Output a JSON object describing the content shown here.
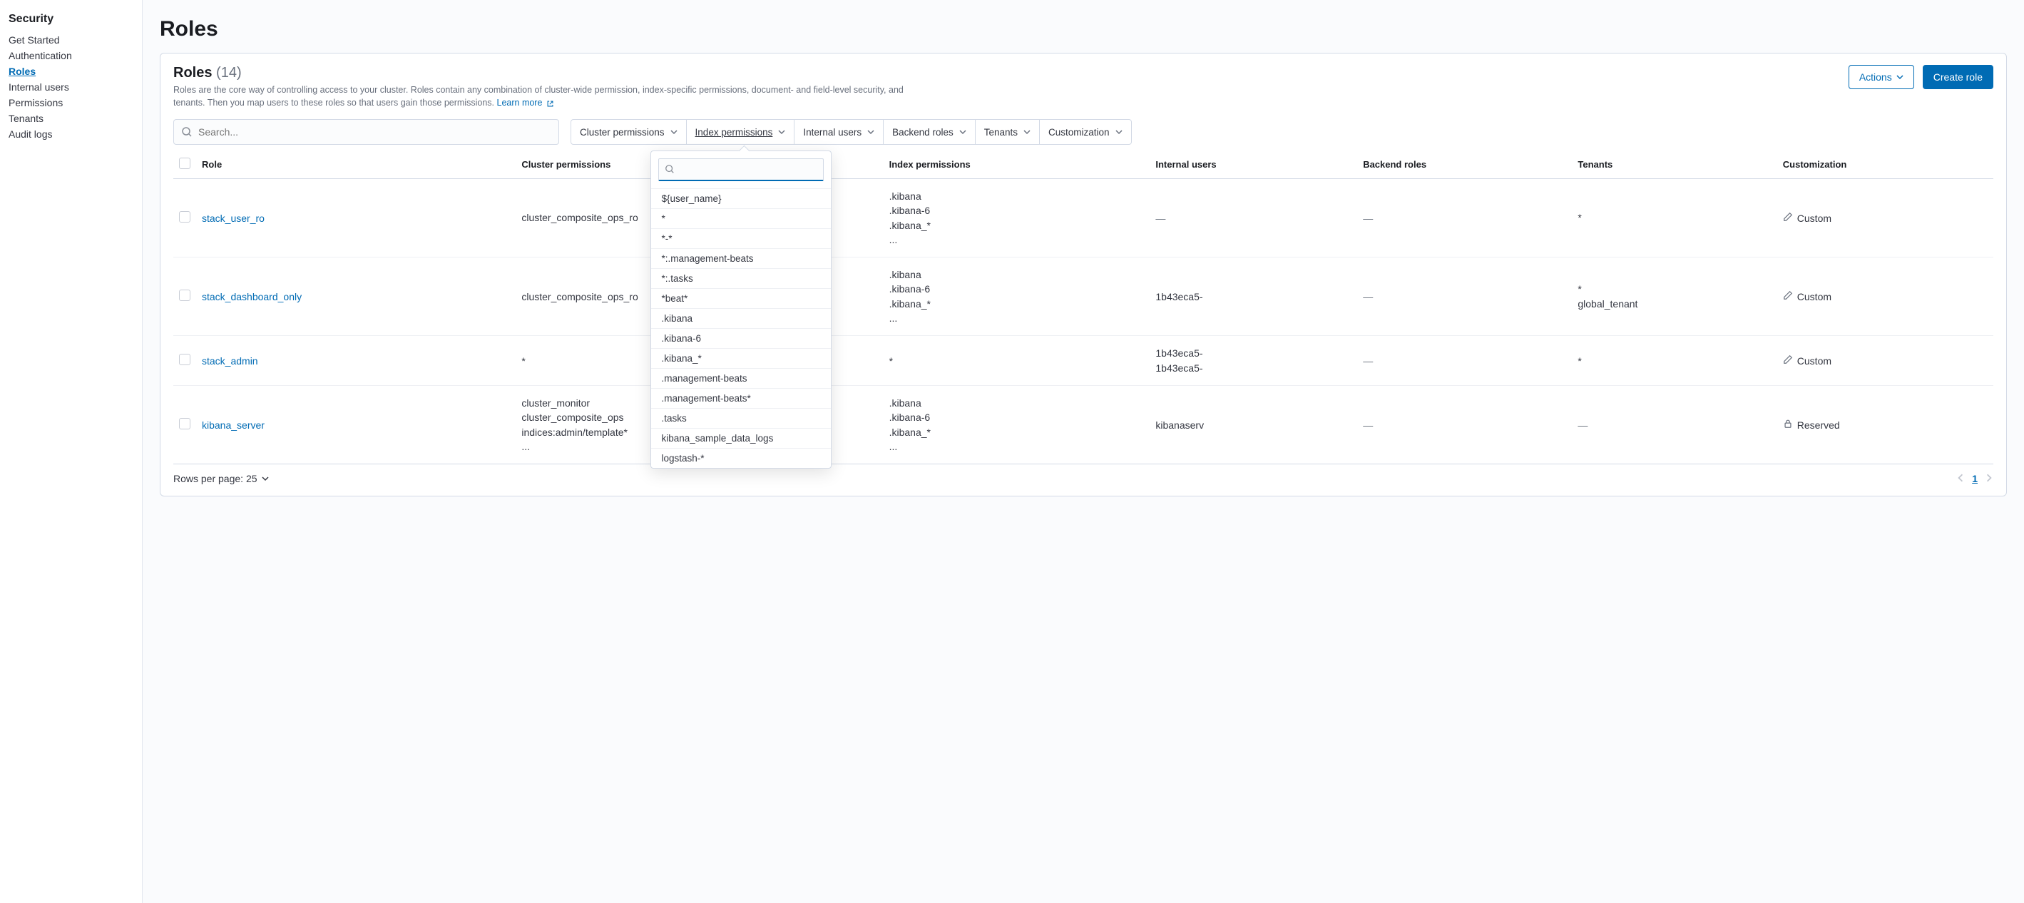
{
  "sidebar": {
    "title": "Security",
    "items": [
      {
        "label": "Get Started",
        "active": false
      },
      {
        "label": "Authentication",
        "active": false
      },
      {
        "label": "Roles",
        "active": true
      },
      {
        "label": "Internal users",
        "active": false
      },
      {
        "label": "Permissions",
        "active": false
      },
      {
        "label": "Tenants",
        "active": false
      },
      {
        "label": "Audit logs",
        "active": false
      }
    ]
  },
  "page": {
    "title": "Roles"
  },
  "panel": {
    "title": "Roles",
    "count": "(14)",
    "description": "Roles are the core way of controlling access to your cluster. Roles contain any combination of cluster-wide permission, index-specific permissions, document- and field-level security, and tenants. Then you map users to these roles so that users gain those permissions.",
    "learn_more": "Learn more",
    "actions_label": "Actions",
    "create_label": "Create role"
  },
  "search": {
    "placeholder": "Search..."
  },
  "filters": [
    {
      "label": "Cluster permissions",
      "active": false
    },
    {
      "label": "Index permissions",
      "active": true
    },
    {
      "label": "Internal users",
      "active": false
    },
    {
      "label": "Backend roles",
      "active": false
    },
    {
      "label": "Tenants",
      "active": false
    },
    {
      "label": "Customization",
      "active": false
    }
  ],
  "columns": {
    "role": "Role",
    "cluster": "Cluster permissions",
    "index": "Index permissions",
    "internal": "Internal users",
    "backend": "Backend roles",
    "tenants": "Tenants",
    "customization": "Customization"
  },
  "rows": [
    {
      "role": "stack_user_ro",
      "cluster": [
        "cluster_composite_ops_ro"
      ],
      "index": [
        ".kibana",
        ".kibana-6",
        ".kibana_*",
        "..."
      ],
      "internal": "—",
      "backend": "—",
      "tenants": [
        "*"
      ],
      "customization": {
        "type": "custom",
        "label": "Custom"
      }
    },
    {
      "role": "stack_dashboard_only",
      "cluster": [
        "cluster_composite_ops_ro"
      ],
      "index": [
        ".kibana",
        ".kibana-6",
        ".kibana_*",
        "..."
      ],
      "internal": "1b43eca5-",
      "backend": "—",
      "tenants": [
        "*",
        "global_tenant"
      ],
      "customization": {
        "type": "custom",
        "label": "Custom"
      }
    },
    {
      "role": "stack_admin",
      "cluster": [
        "*"
      ],
      "index": [
        "*"
      ],
      "internal": "1b43eca5-\n1b43eca5-",
      "backend": "—",
      "tenants": [
        "*"
      ],
      "customization": {
        "type": "custom",
        "label": "Custom"
      }
    },
    {
      "role": "kibana_server",
      "cluster": [
        "cluster_monitor",
        "cluster_composite_ops",
        "indices:admin/template*",
        "..."
      ],
      "index": [
        ".kibana",
        ".kibana-6",
        ".kibana_*",
        "..."
      ],
      "internal": "kibanaserv",
      "backend": "—",
      "tenants": "—",
      "customization": {
        "type": "reserved",
        "label": "Reserved"
      }
    }
  ],
  "footer": {
    "rows_label": "Rows per page: 25",
    "page": "1"
  },
  "popover": {
    "items": [
      "${user_name}",
      "*",
      "*-*",
      "*:.management-beats",
      "*:.tasks",
      "*beat*",
      ".kibana",
      ".kibana-6",
      ".kibana_*",
      ".management-beats",
      ".management-beats*",
      ".tasks",
      "kibana_sample_data_logs",
      "logstash-*"
    ]
  }
}
